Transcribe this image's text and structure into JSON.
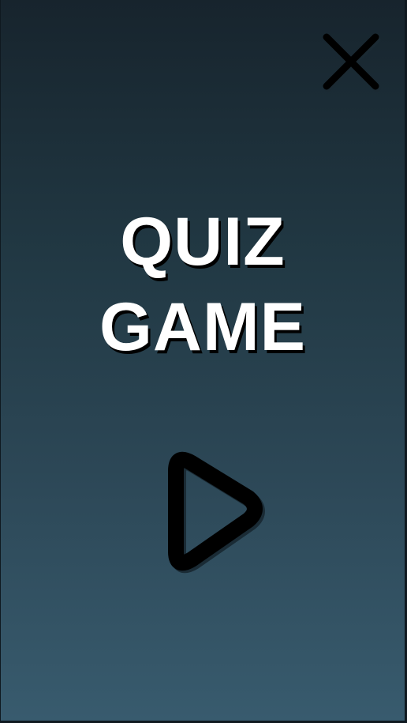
{
  "title": {
    "line1": "QUIZ",
    "line2": "GAME"
  },
  "close_button": {
    "icon": "close-icon"
  },
  "play_button": {
    "icon": "play-icon"
  },
  "colors": {
    "background_top": "#17242d",
    "background_bottom": "#385b6e",
    "title_text": "#ffffff",
    "icon_stroke": "#000000"
  }
}
